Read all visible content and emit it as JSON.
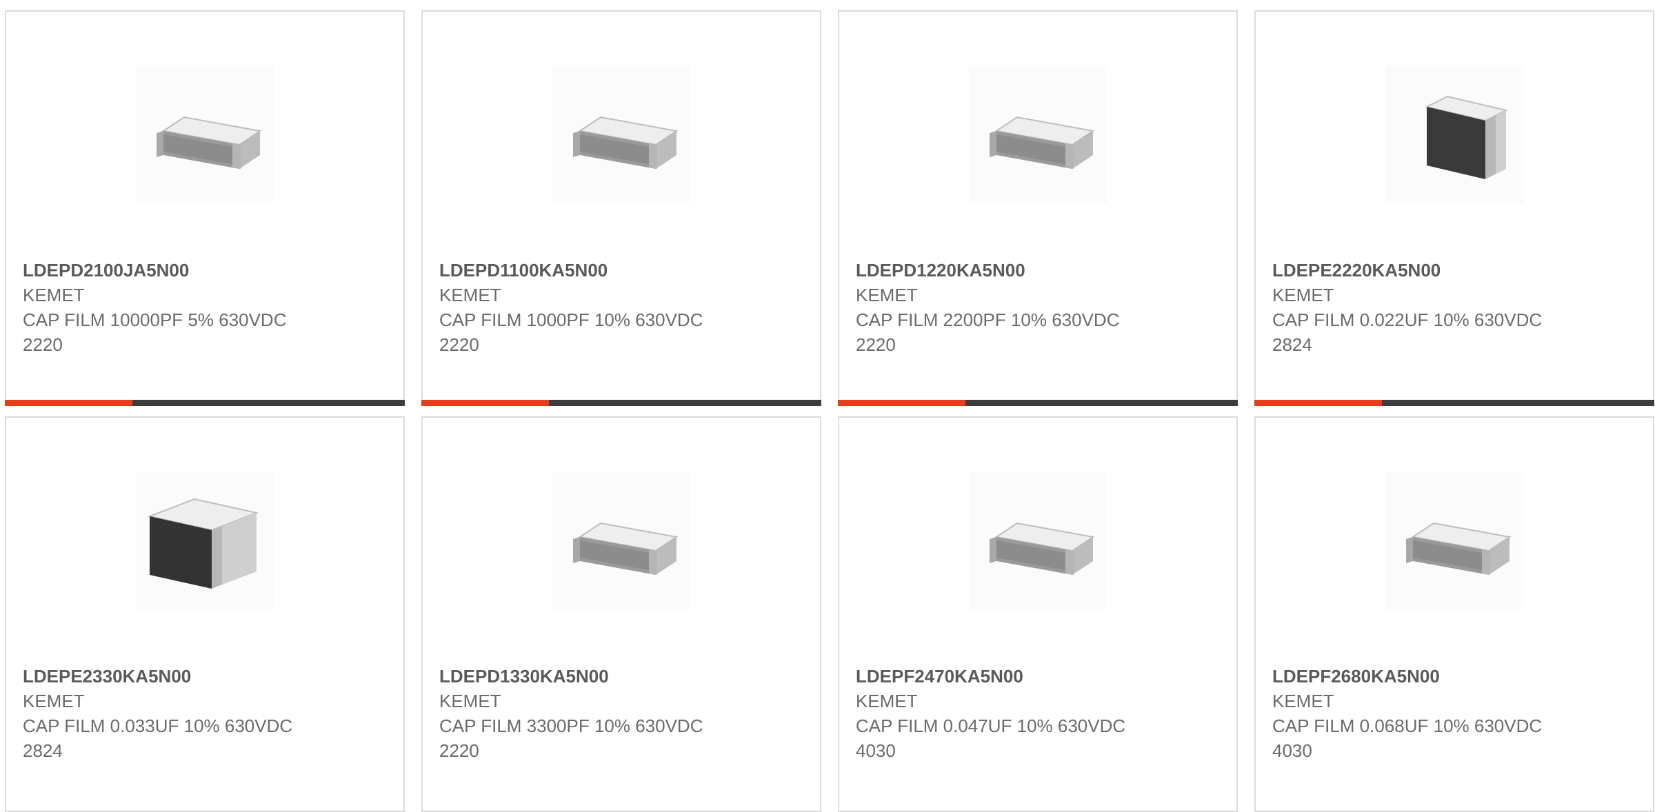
{
  "colors": {
    "accent": "#e2401c",
    "bar": "#3c3c3c",
    "border": "#dcdcdc",
    "text": "#6b6b6b"
  },
  "products": [
    {
      "part_number": "LDEPD2100JA5N00",
      "manufacturer": "KEMET",
      "description": "CAP FILM 10000PF 5% 630VDC 2220",
      "image_icon": "film-capacitor-icon"
    },
    {
      "part_number": "LDEPD1100KA5N00",
      "manufacturer": "KEMET",
      "description": "CAP FILM 1000PF 10% 630VDC 2220",
      "image_icon": "film-capacitor-icon"
    },
    {
      "part_number": "LDEPD1220KA5N00",
      "manufacturer": "KEMET",
      "description": "CAP FILM 2200PF 10% 630VDC 2220",
      "image_icon": "film-capacitor-icon"
    },
    {
      "part_number": "LDEPE2220KA5N00",
      "manufacturer": "KEMET",
      "description": "CAP FILM 0.022UF 10% 630VDC 2824",
      "image_icon": "film-capacitor-icon"
    },
    {
      "part_number": "LDEPE2330KA5N00",
      "manufacturer": "KEMET",
      "description": "CAP FILM 0.033UF 10% 630VDC 2824",
      "image_icon": "film-capacitor-icon"
    },
    {
      "part_number": "LDEPD1330KA5N00",
      "manufacturer": "KEMET",
      "description": "CAP FILM 3300PF 10% 630VDC 2220",
      "image_icon": "film-capacitor-icon"
    },
    {
      "part_number": "LDEPF2470KA5N00",
      "manufacturer": "KEMET",
      "description": "CAP FILM 0.047UF 10% 630VDC 4030",
      "image_icon": "film-capacitor-icon"
    },
    {
      "part_number": "LDEPF2680KA5N00",
      "manufacturer": "KEMET",
      "description": "CAP FILM 0.068UF 10% 630VDC 4030",
      "image_icon": "film-capacitor-icon"
    }
  ]
}
